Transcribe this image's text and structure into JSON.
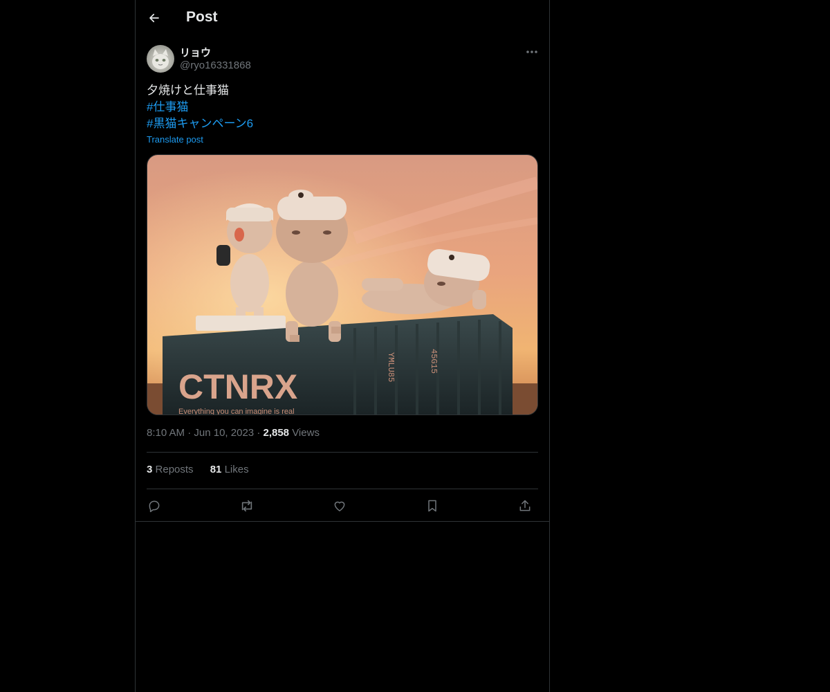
{
  "header": {
    "back_icon": "arrow-left-icon",
    "title": "Post"
  },
  "author": {
    "avatar_icon": "avatar-cat-figure",
    "display_name": "リョウ",
    "handle": "@ryo16331868",
    "more_icon": "more-horizontal-icon"
  },
  "post": {
    "text": "夕焼けと仕事猫",
    "hashtags": [
      "#仕事猫",
      "#黒猫キャンペーン6"
    ],
    "translate_label": "Translate post",
    "image": {
      "depicts": "photo-of-three-cat-figurines-on-shipping-container-at-sunset",
      "printed_text": [
        "CTNRX",
        "Everything you can imagine is real",
        "YMLU85",
        "45G15"
      ]
    }
  },
  "meta": {
    "time": "8:10 AM",
    "separator": "·",
    "date": "Jun 10, 2023",
    "views_count": "2,858",
    "views_label": "Views"
  },
  "stats": {
    "reposts_count": "3",
    "reposts_label": "Reposts",
    "likes_count": "81",
    "likes_label": "Likes"
  },
  "actions": {
    "reply_icon": "reply-icon",
    "repost_icon": "repost-icon",
    "like_icon": "heart-icon",
    "bookmark_icon": "bookmark-icon",
    "share_icon": "share-icon"
  },
  "colors": {
    "background": "#000000",
    "text": "#e7e9ea",
    "secondary_text": "#71767b",
    "accent": "#1d9bf0",
    "border": "#2f3336"
  }
}
